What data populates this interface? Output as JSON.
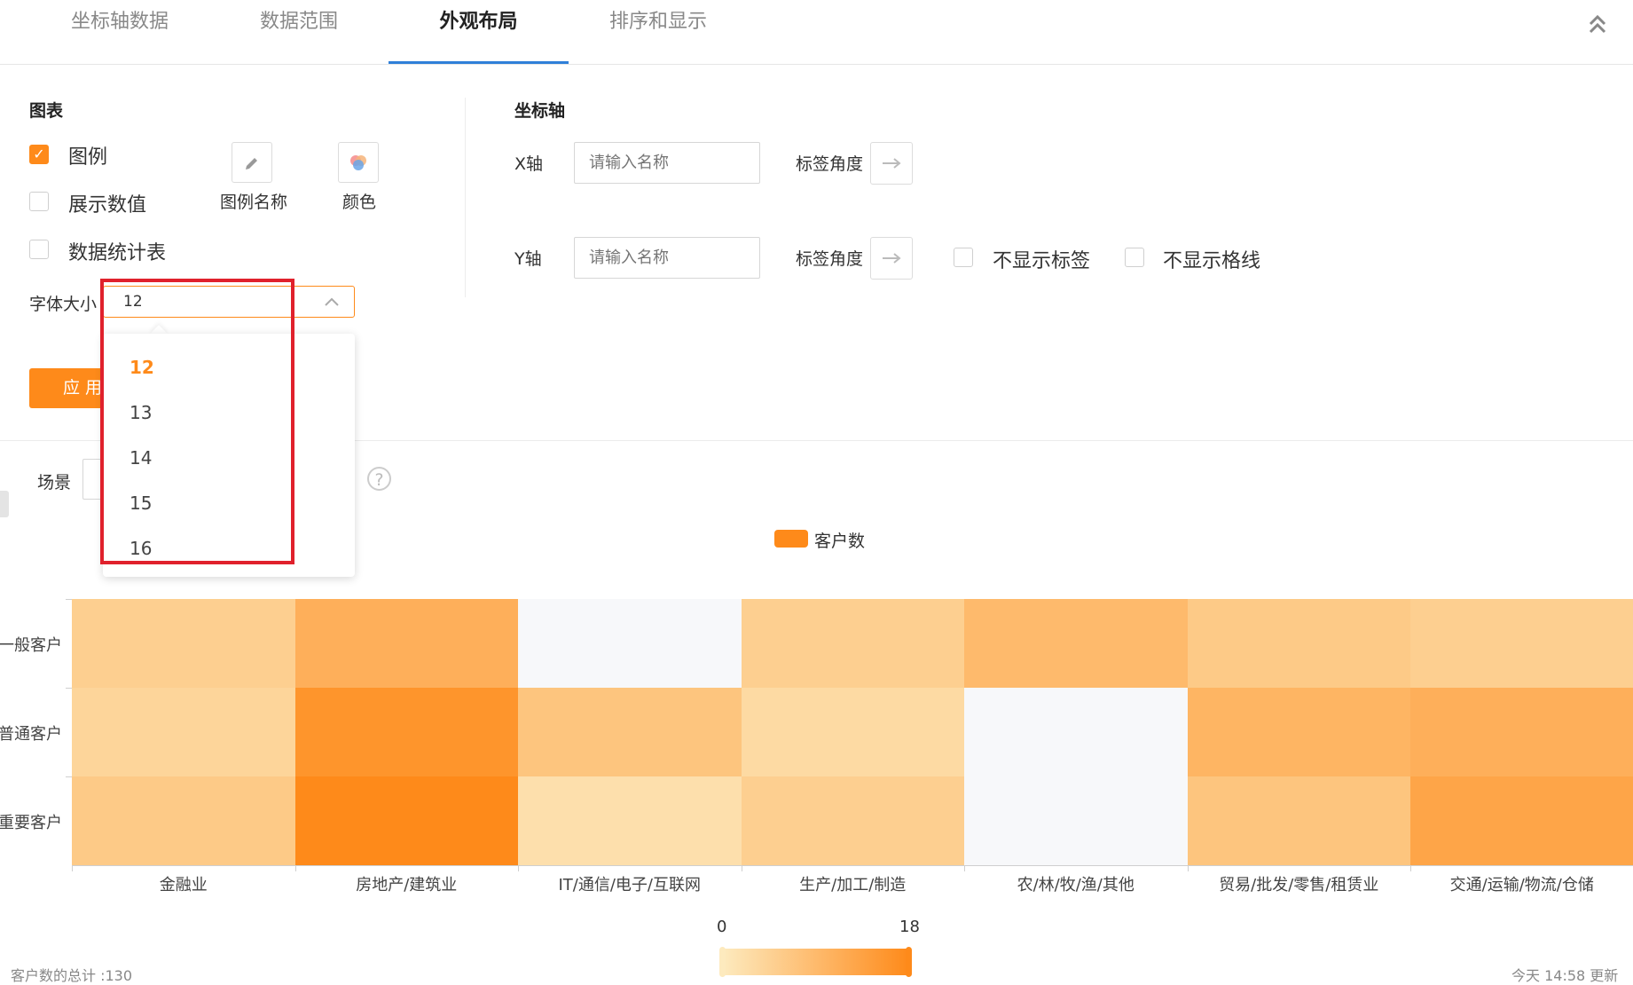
{
  "tabs": [
    {
      "label": "坐标轴数据",
      "active": false
    },
    {
      "label": "数据范围",
      "active": false
    },
    {
      "label": "外观布局",
      "active": true
    },
    {
      "label": "排序和显示",
      "active": false
    }
  ],
  "chart_section": {
    "title": "图表",
    "legend_checkbox": {
      "label": "图例",
      "checked": true
    },
    "show_values_checkbox": {
      "label": "展示数值",
      "checked": false
    },
    "data_table_checkbox": {
      "label": "数据统计表",
      "checked": false
    },
    "legend_name_label": "图例名称",
    "color_label": "颜色",
    "font_size_label": "字体大小",
    "font_size_value": "12",
    "font_size_options": [
      "12",
      "13",
      "14",
      "15",
      "16"
    ],
    "apply_label": "应 用"
  },
  "axis_section": {
    "title": "坐标轴",
    "x_axis_label": "X轴",
    "x_axis_placeholder": "请输入名称",
    "x_tag_angle_label": "标签角度",
    "y_axis_label": "Y轴",
    "y_axis_placeholder": "请输入名称",
    "y_tag_angle_label": "标签角度",
    "hide_labels": {
      "label": "不显示标签",
      "checked": false
    },
    "hide_gridlines": {
      "label": "不显示格线",
      "checked": false
    }
  },
  "scene_label": "场景",
  "chart_data": {
    "type": "heatmap",
    "legend": [
      "客户数"
    ],
    "x_categories": [
      "金融业",
      "房地产/建筑业",
      "IT/通信/电子/互联网",
      "生产/加工/制造",
      "农/林/牧/渔/其他",
      "贸易/批发/零售/租赁业",
      "交通/运输/物流/仓储"
    ],
    "y_categories": [
      "一般客户",
      "普通客户",
      "重要客户"
    ],
    "values": [
      [
        5,
        11,
        0,
        5,
        9,
        6,
        5
      ],
      [
        4,
        16,
        7,
        3,
        0,
        10,
        11
      ],
      [
        6,
        18,
        2,
        5,
        0,
        7,
        13
      ]
    ],
    "visual_map": {
      "min": 0,
      "max": 18,
      "min_label": "0",
      "max_label": "18"
    },
    "colors": {
      "low": "#fdeabe",
      "high": "#fe8a1a",
      "empty": "#f7f8fa"
    }
  },
  "footer": {
    "total": "客户数的总计 :130",
    "updated": "今天 14:58 更新"
  },
  "accent_color": "#fe8a1a"
}
